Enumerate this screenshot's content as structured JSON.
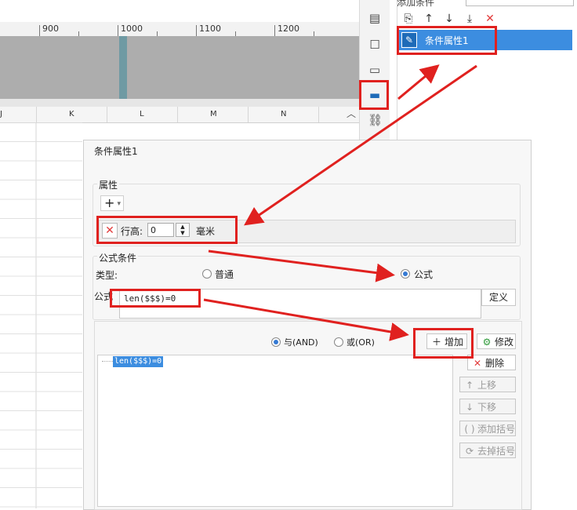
{
  "ruler": {
    "labels": [
      "900",
      "1000",
      "1100",
      "1200"
    ]
  },
  "columns": [
    "J",
    "K",
    "L",
    "M",
    "N"
  ],
  "right_panel": {
    "header_label": "添加条件",
    "items": [
      {
        "label": "条件属性1"
      }
    ]
  },
  "dialog": {
    "title": "条件属性1",
    "property_group": "属性",
    "row_height_label": "行高:",
    "row_height_value": "0",
    "unit": "毫米",
    "formula_condition_group": "公式条件",
    "type_label": "类型:",
    "type_options": [
      "普通",
      "公式"
    ],
    "selected_type": "公式",
    "formula_label": "公式",
    "formula_text": "len($$$)=0",
    "define_button": "定义",
    "logic_options": [
      "与(AND)",
      "或(OR)"
    ],
    "selected_logic": "与(AND)",
    "buttons": {
      "add": "增加",
      "modify": "修改",
      "delete": "删除",
      "move_up": "上移",
      "move_down": "下移",
      "add_bracket": "添加括号",
      "remove_bracket": "去掉括号"
    },
    "condition_list": [
      "len($$$)=0"
    ]
  },
  "colors": {
    "accent": "#3c8de0",
    "annotation": "#e0211f",
    "delete": "#e23c3c"
  }
}
